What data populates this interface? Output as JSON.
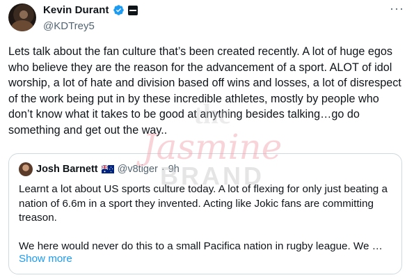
{
  "tweet": {
    "author": {
      "display_name": "Kevin Durant",
      "handle": "@KDTrey5",
      "avatar_icon": "profile-photo",
      "verified_icon": "verified-badge-icon",
      "affiliation_icon": "brand-affiliation-icon"
    },
    "more_icon": "···",
    "text": "Lets talk about the fan culture that’s been created recently. A lot of huge egos who believe they are the reason for the advancement of a sport. ALOT of idol worship, a lot of hate and division based off wins and losses, a lot of disrespect of the work being put in by these incredible athletes, mostly by people who don’t know what it takes to be good at anything besides talking…go do something and get out the way..",
    "quote": {
      "display_name": "Josh Barnett",
      "flag_icon": "australia-flag-icon",
      "handle": "@v8tiger",
      "separator": "·",
      "time": "9h",
      "text": "Learnt a lot about US sports culture today. A lot of flexing for only just beating a nation of 6.6m in a sport they invented. Acting like Jokic fans are committing treason.\n\nWe here would never do this to a small Pacifica nation in rugby league. We …",
      "show_more": "Show more"
    }
  },
  "watermark": {
    "line1": "the",
    "line2": "Jasmine",
    "line3": "BRAND"
  },
  "colors": {
    "text": "#0f1419",
    "secondary": "#536471",
    "link": "#1d9bf0",
    "border": "#cfd9de",
    "verified": "#1d9bf0"
  }
}
